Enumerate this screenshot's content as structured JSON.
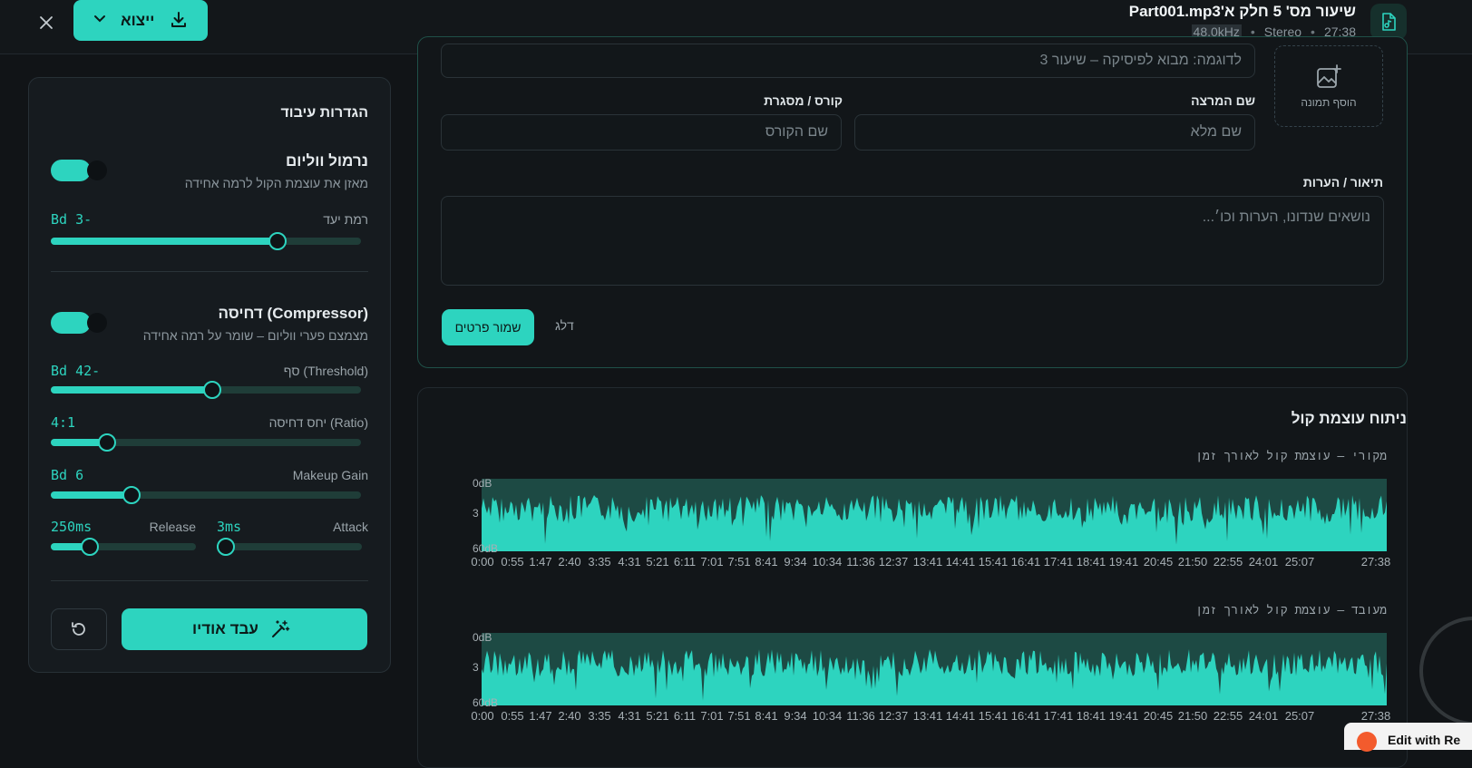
{
  "header": {
    "export_label": "ייצוא",
    "file_title": "שיעור מס' 5 חלק א'Part001.mp3",
    "sample_rate": "48.0kHz",
    "channels": "Stereo",
    "duration": "27:38"
  },
  "settings": {
    "title": "הגדרות עיבוד",
    "normalize": {
      "title": "נרמול ווליום",
      "subtitle": "מאזן את עוצמת הקול לרמה אחידה",
      "enabled": true,
      "target_label": "רמת יעד",
      "target_value": "-3 dB",
      "target_fraction": 0.73
    },
    "compressor": {
      "title": "דחיסה (Compressor)",
      "subtitle": "מצמצם פערי ווליום – שומר על רמה אחידה",
      "enabled": true,
      "threshold_label": "סף (Threshold)",
      "threshold_value": "-24 dB",
      "threshold_fraction": 0.52,
      "ratio_label": "יחס דחיסה (Ratio)",
      "ratio_value": "4:1",
      "ratio_fraction": 0.18,
      "makeup_label": "Makeup Gain",
      "makeup_value": "6 dB",
      "makeup_fraction": 0.26,
      "release_label": "Release",
      "release_value": "250ms",
      "release_fraction": 0.27,
      "attack_label": "Attack",
      "attack_value": "3ms",
      "attack_fraction": 0.06
    },
    "process_label": "עבד אודיו"
  },
  "details": {
    "title_placeholder": "לדוגמה: מבוא לפיסיקה – שיעור 3",
    "add_image_label": "הוסף תמונה",
    "lecturer_label": "שם המרצה",
    "lecturer_placeholder": "שם מלא",
    "course_label": "קורס / מסגרת",
    "course_placeholder": "שם הקורס",
    "description_label": "תיאור / הערות",
    "description_placeholder": "נושאים שנדונו, הערות וכו׳...",
    "save_label": "שמור פרטים",
    "skip_label": "דלג"
  },
  "analysis": {
    "title": "ניתוח עוצמת קול",
    "original_label": "מקורי – עוצמת קול לאורך זמן",
    "processed_label": "מעובד – עוצמת קול לאורך זמן",
    "db_top": "0dB",
    "db_mid": "3",
    "db_bottom": "60dB",
    "time_ticks": [
      "0:00",
      "0:55",
      "1:47",
      "2:40",
      "3:35",
      "4:31",
      "5:21",
      "6:11",
      "7:01",
      "7:51",
      "8:41",
      "9:34",
      "10:34",
      "11:36",
      "12:37",
      "13:41",
      "14:41",
      "15:41",
      "16:41",
      "17:41",
      "18:41",
      "19:41",
      "20:45",
      "21:50",
      "22:55",
      "24:01",
      "25:07",
      "27:38"
    ]
  },
  "overlay": {
    "edit_with": "Edit with Re"
  },
  "colors": {
    "accent": "#2dd4bf",
    "background": "#111417"
  }
}
